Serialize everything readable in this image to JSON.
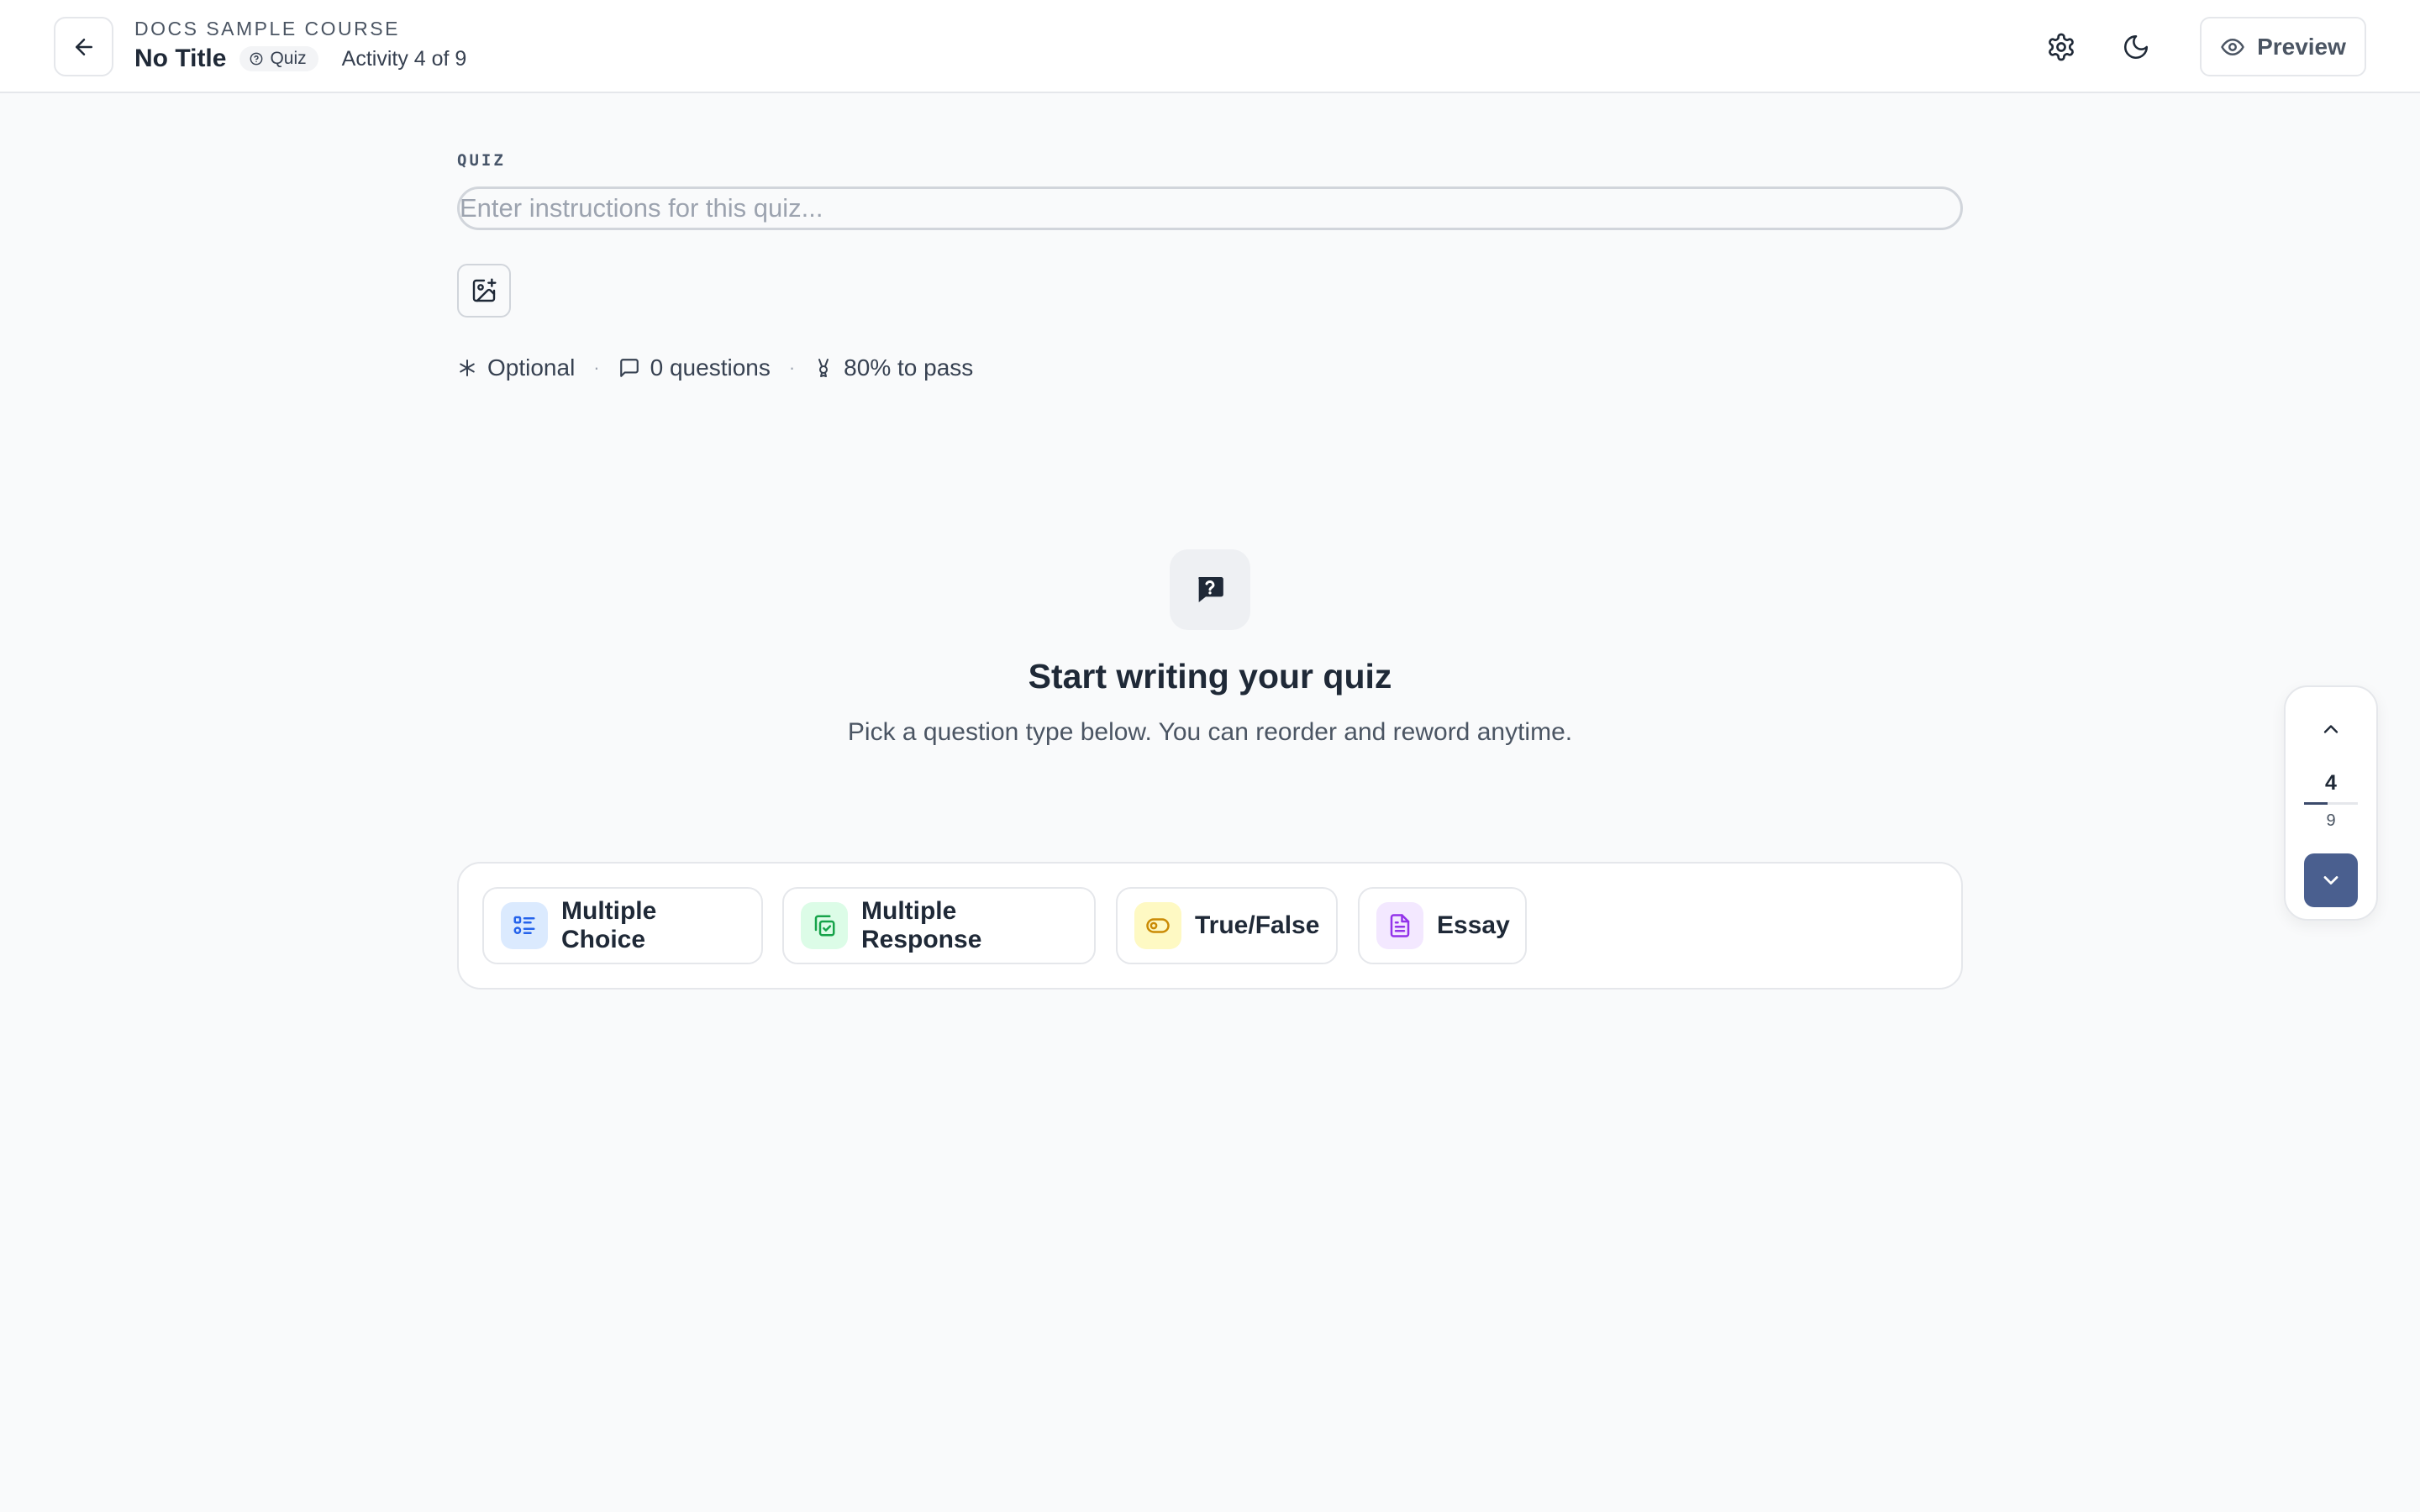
{
  "header": {
    "course_name": "DOCS SAMPLE COURSE",
    "title": "No Title",
    "type_badge": "Quiz",
    "activity": "Activity 4 of 9",
    "preview_label": "Preview"
  },
  "quiz": {
    "section_label": "QUIZ",
    "instructions_placeholder": "Enter instructions for this quiz...",
    "instructions_value": "",
    "meta": {
      "optional": "Optional",
      "questions": "0 questions",
      "pass": "80% to pass"
    }
  },
  "empty_state": {
    "title": "Start writing your quiz",
    "subtitle": "Pick a question type below. You can reorder and reword anytime."
  },
  "question_types": [
    {
      "label": "Multiple Choice",
      "icon": "list-icon",
      "color": "#2563eb",
      "bg": "#dbeafe"
    },
    {
      "label": "Multiple Response",
      "icon": "copy-check-icon",
      "color": "#16a34a",
      "bg": "#dcfce7"
    },
    {
      "label": "True/False",
      "icon": "toggle-icon",
      "color": "#ca8a04",
      "bg": "#fef9c3"
    },
    {
      "label": "Essay",
      "icon": "document-icon",
      "color": "#9333ea",
      "bg": "#f3e8ff"
    }
  ],
  "navigator": {
    "current": "4",
    "total": "9",
    "progress": 0.444
  },
  "colors": {
    "accent": "#4a5f8f",
    "border": "#e5e7eb",
    "background": "#f9fafb"
  }
}
